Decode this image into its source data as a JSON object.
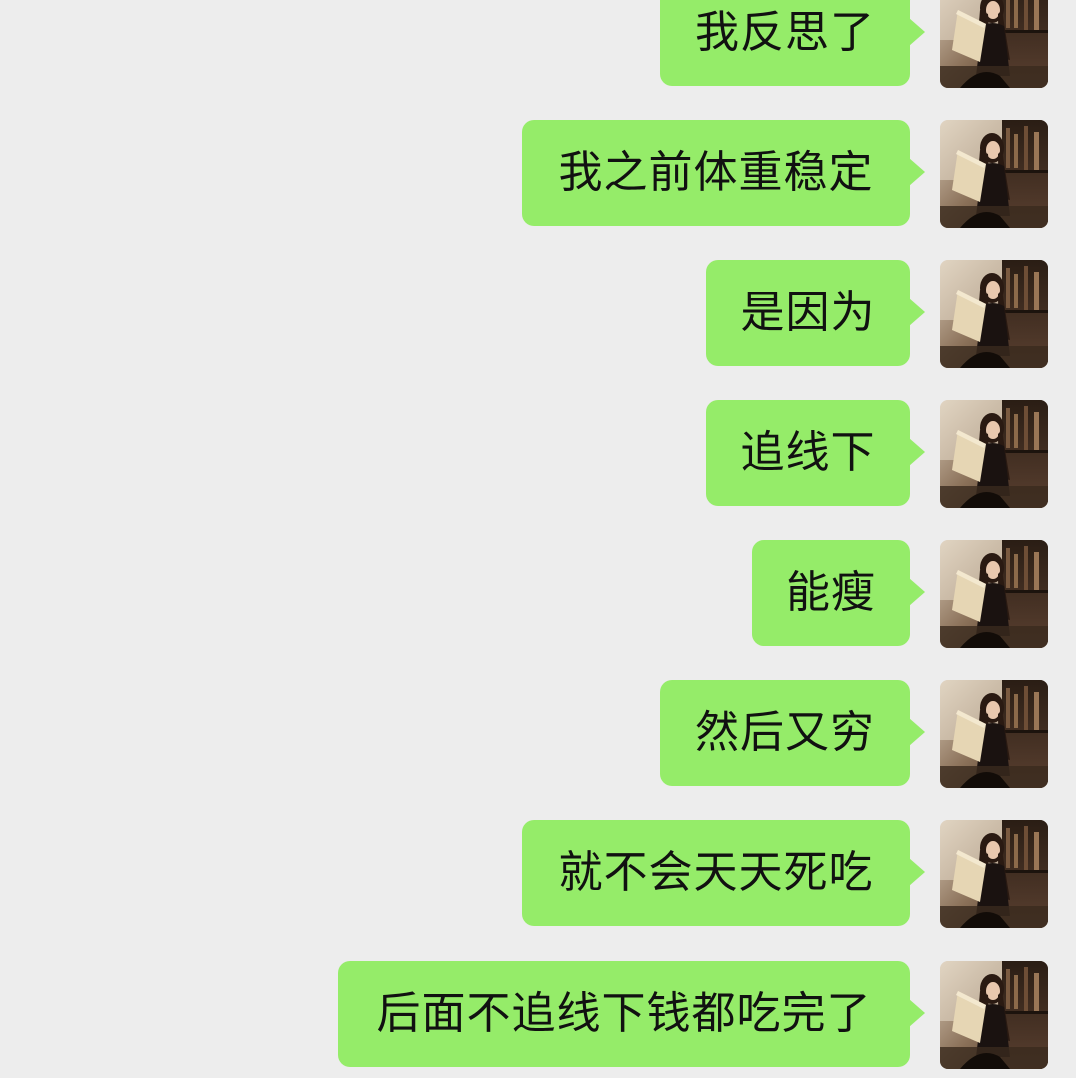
{
  "chat": {
    "messages": [
      {
        "text": "我反思了"
      },
      {
        "text": "我之前体重稳定"
      },
      {
        "text": "是因为"
      },
      {
        "text": "追线下"
      },
      {
        "text": "能瘦"
      },
      {
        "text": "然后又穷"
      },
      {
        "text": "就不会天天死吃"
      },
      {
        "text": "后面不追线下钱都吃完了"
      }
    ],
    "bubble_color": "#95ec69",
    "background_color": "#ededed",
    "avatar_icon": "user-avatar-photo"
  }
}
